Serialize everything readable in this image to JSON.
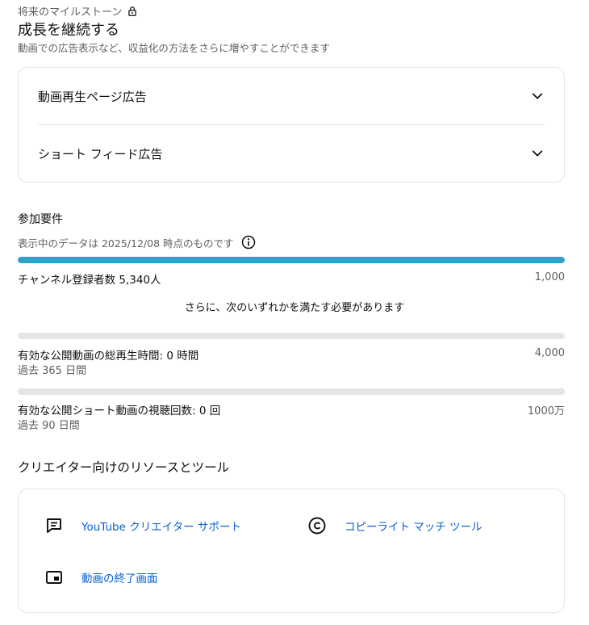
{
  "milestone": {
    "future_label": "将来のマイルストーン",
    "title": "成長を継続する",
    "description": "動画での広告表示など、収益化の方法をさらに増やすことができます"
  },
  "ads": {
    "items": [
      {
        "label": "動画再生ページ広告"
      },
      {
        "label": "ショート フィード広告"
      }
    ]
  },
  "requirements": {
    "title": "参加要件",
    "data_note": "表示中のデータは 2025/12/08 時点のものです",
    "subscribers": {
      "label": "チャンネル登録者数 5,340人",
      "target": "1,000",
      "progress": 1.0
    },
    "also_text": "さらに、次のいずれかを満たす必要があります",
    "watch_hours": {
      "label": "有効な公開動画の総再生時間: 0 時間",
      "target": "4,000",
      "period": "過去 365 日間",
      "progress": 0.0
    },
    "shorts_views": {
      "label": "有効な公開ショート動画の視聴回数: 0 回",
      "target": "1000万",
      "period": "過去 90 日間",
      "progress": 0.0
    }
  },
  "resources": {
    "title": "クリエイター向けのリソースとツール",
    "items": [
      {
        "label": "YouTube クリエイター サポート",
        "icon": "feedback-icon"
      },
      {
        "label": "コピーライト マッチ ツール",
        "icon": "copyright-icon"
      },
      {
        "label": "動画の終了画面",
        "icon": "end-screen-icon"
      }
    ]
  },
  "colors": {
    "progress_fill": "#2ea1c8",
    "link": "#065fd4",
    "secondary_text": "#606060"
  }
}
